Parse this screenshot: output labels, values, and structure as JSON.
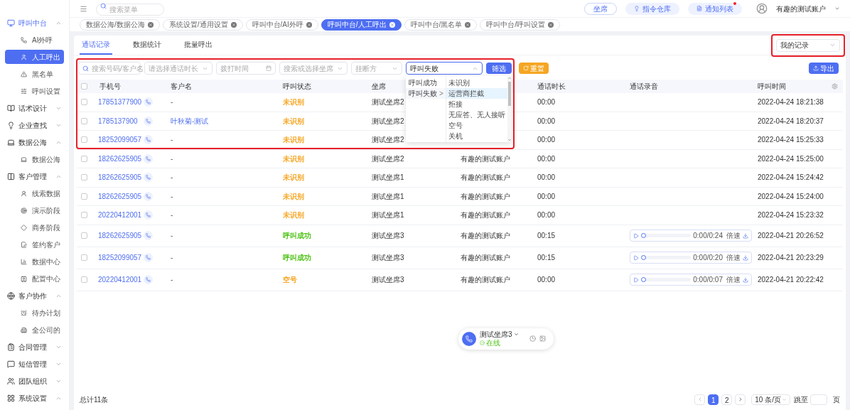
{
  "sidebar": {
    "items": [
      {
        "label": "呼叫中台",
        "expanded": true,
        "children": [
          {
            "label": "AI外呼",
            "selected": false
          },
          {
            "label": "人工呼出",
            "selected": true
          },
          {
            "label": "黑名单",
            "selected": false
          },
          {
            "label": "呼叫设置",
            "selected": false
          }
        ]
      },
      {
        "label": "话术设计",
        "expanded": false
      },
      {
        "label": "企业查找",
        "expanded": false
      },
      {
        "label": "数据公海",
        "expanded": true,
        "children": [
          {
            "label": "数据公海",
            "selected": false
          }
        ]
      },
      {
        "label": "客户管理",
        "expanded": true,
        "children": [
          {
            "label": "线索数据",
            "selected": false
          },
          {
            "label": "演示阶段",
            "selected": false
          },
          {
            "label": "商务阶段",
            "selected": false
          },
          {
            "label": "签约客户",
            "selected": false
          },
          {
            "label": "数据中心",
            "selected": false
          },
          {
            "label": "配置中心",
            "selected": false
          }
        ]
      },
      {
        "label": "客户协作",
        "expanded": true,
        "children": [
          {
            "label": "待办计划",
            "selected": false
          },
          {
            "label": "全公司的",
            "selected": false
          }
        ]
      },
      {
        "label": "合同管理",
        "expanded": false
      },
      {
        "label": "短信管理",
        "expanded": false
      },
      {
        "label": "团队组织",
        "expanded": false
      },
      {
        "label": "系统设置",
        "expanded": true
      }
    ]
  },
  "topbar": {
    "search_placeholder": "搜索菜单",
    "buttons": [
      {
        "label": "坐席",
        "badge": false
      },
      {
        "label": "指令仓库",
        "badge": false
      },
      {
        "label": "通知列表",
        "badge": true
      }
    ],
    "user": "有趣的测试账户"
  },
  "open_tabs": [
    {
      "label": "数据公海/数据公海",
      "selected": false
    },
    {
      "label": "系统设置/通用设置",
      "selected": false
    },
    {
      "label": "呼叫中台/AI外呼",
      "selected": false
    },
    {
      "label": "呼叫中台/人工呼出",
      "selected": true
    },
    {
      "label": "呼叫中台/黑名单",
      "selected": false
    },
    {
      "label": "呼叫中台/呼叫设置",
      "selected": false
    }
  ],
  "page_tabs": [
    {
      "label": "通话记录",
      "selected": true
    },
    {
      "label": "数据统计",
      "selected": false
    },
    {
      "label": "批量呼出",
      "selected": false
    }
  ],
  "record_select": {
    "value": "我的记录",
    "highlighted": true
  },
  "filters": {
    "highlighted": true,
    "search_placeholder": "搜索号码/客户名",
    "duration_placeholder": "请选择通话时长",
    "date_placeholder": "拨打时间",
    "seat_placeholder": "搜索或选择坐席",
    "hangup_placeholder": "挂断方",
    "status_value": "呼叫失败",
    "filter_button": "筛选",
    "reset_button": "重置",
    "export_button": "导出"
  },
  "status_dropdown": {
    "expanded": true,
    "options": [
      {
        "label": "呼叫成功",
        "selected": false
      },
      {
        "label": "呼叫失败",
        "selected": true,
        "arrow": ">"
      }
    ],
    "sub_options": [
      {
        "label": "未识别",
        "selected": false
      },
      {
        "label": "运营商拦截",
        "selected": true
      },
      {
        "label": "拒接",
        "selected": false
      },
      {
        "label": "无应答、无人接听",
        "selected": false
      },
      {
        "label": "空号",
        "selected": false
      },
      {
        "label": "关机",
        "selected": false
      }
    ]
  },
  "table": {
    "all_checked": false,
    "columns": [
      "手机号",
      "客户名",
      "呼叫状态",
      "坐席",
      "通话时长",
      "通话录音",
      "呼叫时间"
    ],
    "rows": [
      {
        "checked": false,
        "phone": "17851377900",
        "customer": "-",
        "linked": false,
        "status": "未识别",
        "color": "#f5a623",
        "seat": "测试坐席2",
        "column_5": null,
        "duration": "00:00",
        "recording": null,
        "time": "2022-04-24 18:21:38"
      },
      {
        "checked": false,
        "phone": "1785137900",
        "customer": "叶秋菊-测试",
        "linked": true,
        "status": "未识别",
        "color": "#f5a623",
        "seat": "测试坐席2",
        "column_5": null,
        "duration": "00:00",
        "recording": null,
        "time": "2022-04-24 18:20:37"
      },
      {
        "checked": false,
        "phone": "18252099057",
        "customer": "-",
        "linked": false,
        "status": "未识别",
        "color": "#f5a623",
        "seat": "测试坐席2",
        "column_5": null,
        "duration": "00:00",
        "recording": null,
        "time": "2022-04-24 15:25:33"
      },
      {
        "checked": false,
        "phone": "18262625905",
        "customer": "-",
        "linked": false,
        "status": "未识别",
        "color": "#f5a623",
        "seat": "测试坐席2",
        "column_5": "有趣的测试账户",
        "duration": "00:00",
        "recording": null,
        "time": "2022-04-24 15:25:00"
      },
      {
        "checked": false,
        "phone": "18262625905",
        "customer": "-",
        "linked": false,
        "status": "未识别",
        "color": "#f5a623",
        "seat": "测试坐席1",
        "column_5": "有趣的测试账户",
        "duration": "00:00",
        "recording": null,
        "time": "2022-04-24 15:24:42"
      },
      {
        "checked": false,
        "phone": "18262625905",
        "customer": "-",
        "linked": false,
        "status": "未识别",
        "color": "#f5a623",
        "seat": "测试坐席1",
        "column_5": "有趣的测试账户",
        "duration": "00:00",
        "recording": null,
        "time": "2022-04-24 15:24:00"
      },
      {
        "checked": false,
        "phone": "20220412001",
        "customer": "-",
        "linked": false,
        "status": "未识别",
        "color": "#f5a623",
        "seat": "测试坐席1",
        "column_5": "有趣的测试账户",
        "duration": "00:00",
        "recording": null,
        "time": "2022-04-24 15:23:32"
      },
      {
        "checked": false,
        "phone": "18262625905",
        "customer": "-",
        "linked": false,
        "status": "呼叫成功",
        "color": "#52c41a",
        "seat": "测试坐席3",
        "column_5": "有趣的测试账户",
        "duration": "00:15",
        "recording": {
          "time": "0:00/0:24",
          "speed": "倍速"
        },
        "time": "2022-04-21 20:26:52"
      },
      {
        "checked": false,
        "phone": "18252099057",
        "customer": "-",
        "linked": false,
        "status": "呼叫成功",
        "color": "#52c41a",
        "seat": "测试坐席3",
        "column_5": "有趣的测试账户",
        "duration": "00:15",
        "recording": {
          "time": "0:00/0:20",
          "speed": "倍速"
        },
        "time": "2022-04-21 20:23:29"
      },
      {
        "checked": false,
        "phone": "20220412001",
        "customer": "-",
        "linked": false,
        "status": "空号",
        "color": "#f5a623",
        "seat": "测试坐席3",
        "column_5": "有趣的测试账户",
        "duration": "00:00",
        "recording": {
          "time": "0:00/0:07",
          "speed": "倍速"
        },
        "time": "2022-04-21 20:22:42"
      }
    ]
  },
  "call_widget": {
    "seat": "测试坐席3",
    "status": "在线",
    "online": true
  },
  "footer": {
    "total": "总计11条",
    "pages": [
      {
        "label": "1",
        "selected": true
      },
      {
        "label": "2",
        "selected": false
      }
    ],
    "page_size": "10 条/页",
    "jump_label": "跳至",
    "page_unit": "页"
  }
}
